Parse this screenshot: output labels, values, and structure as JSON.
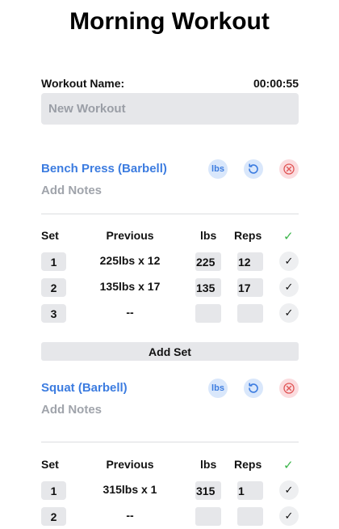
{
  "title": "Morning Workout",
  "workout_name_label": "Workout Name:",
  "timer": "00:00:55",
  "workout_name": {
    "value": "",
    "placeholder": "New Workout"
  },
  "table_headers": {
    "set": "Set",
    "previous": "Previous",
    "weight": "lbs",
    "reps": "Reps",
    "check": "✓"
  },
  "exercises": [
    {
      "name": "Bench Press (Barbell)",
      "unit": "lbs",
      "notes_placeholder": "Add Notes",
      "sets": [
        {
          "set": "1",
          "previous": "225lbs x 12",
          "weight": "225",
          "reps": "12",
          "done": "✓"
        },
        {
          "set": "2",
          "previous": "135lbs x 17",
          "weight": "135",
          "reps": "17",
          "done": "✓"
        },
        {
          "set": "3",
          "previous": "--",
          "weight": "",
          "reps": "",
          "done": "✓"
        }
      ],
      "add_set_label": "Add Set"
    },
    {
      "name": "Squat (Barbell)",
      "unit": "lbs",
      "notes_placeholder": "Add Notes",
      "sets": [
        {
          "set": "1",
          "previous": "315lbs x 1",
          "weight": "315",
          "reps": "1",
          "done": "✓"
        },
        {
          "set": "2",
          "previous": "--",
          "weight": "",
          "reps": "",
          "done": "✓"
        }
      ]
    }
  ],
  "colors": {
    "accent": "#3c7ce0",
    "accent_bg": "#d9e7fb",
    "danger": "#e05555",
    "danger_bg": "#fbdcdf",
    "success": "#3bb54a",
    "field_bg": "#e6e7ea",
    "muted": "#a0a4ab"
  },
  "icons": {
    "unit_toggle": "lbs-text-icon",
    "swap": "refresh-icon",
    "remove": "close-circle-icon",
    "complete": "check-icon"
  }
}
